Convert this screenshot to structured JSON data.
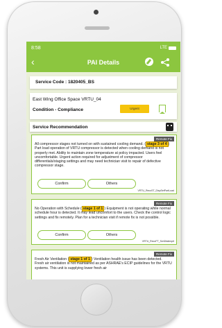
{
  "status_bar": {
    "time": "8:58",
    "signal": "LTE"
  },
  "appbar": {
    "title": "PAI Details",
    "back_icon": "chevron-left-icon",
    "edit_icon": "edit-icon",
    "share_icon": "share-icon"
  },
  "service": {
    "code_label": "Service Code : 1820405_BS"
  },
  "site": {
    "name": "East Wing Office Space VRTU_04",
    "condition": "Condition - Compliance",
    "priority": "Urgent"
  },
  "recommendation": {
    "title": "Service Recommendation",
    "icon": "robot-icon"
  },
  "cards": [
    {
      "tag": "Remote Fix",
      "text_before": "All compressor stages not turned on with sustained cooling demand.",
      "stage": "stage 3 of 4",
      "text_after": "Part load operation of VRTU compressor is detected when cooling demand is not properly met. Ability to maintain zone temperature at policy impacted. Users feel uncomfortable. Urgent action required for adjustment of compressor differentials/staging settings and may need technician visit to repair of defective compressor stage.",
      "confirm": "Confirm",
      "others": "Others",
      "code": "VRTU_RecoST_DispSetPartLoad"
    },
    {
      "tag": "Remote Fix",
      "text_before": "No Operation with Schedule",
      "stage": "stage 1 of 1",
      "text_after": "Equipment is not operating while normal schedule hour is detected. It may lead uncomfort to the users. Check the control logic settings and fix remotely. Plan for a technician visit if remote fix is not possible.",
      "confirm": "Confirm",
      "others": "Others",
      "code": "VRTU_RecoFT_SchDiskImplt"
    },
    {
      "tag": "Remote Fix",
      "text_before": "Fresh Air Ventilation",
      "stage": "stage 1 of 1",
      "text_after": "Ventilation health issue has been detected. Fresh air ventilation is not maintained as per ASHRAE's ECIP guidelines for the VRTU systems. This unit is supplying lower fresh air"
    }
  ],
  "colors": {
    "accent": "#8cc63f",
    "urgent": "#f5c40c",
    "screen_bg": "#eaf0d8"
  }
}
